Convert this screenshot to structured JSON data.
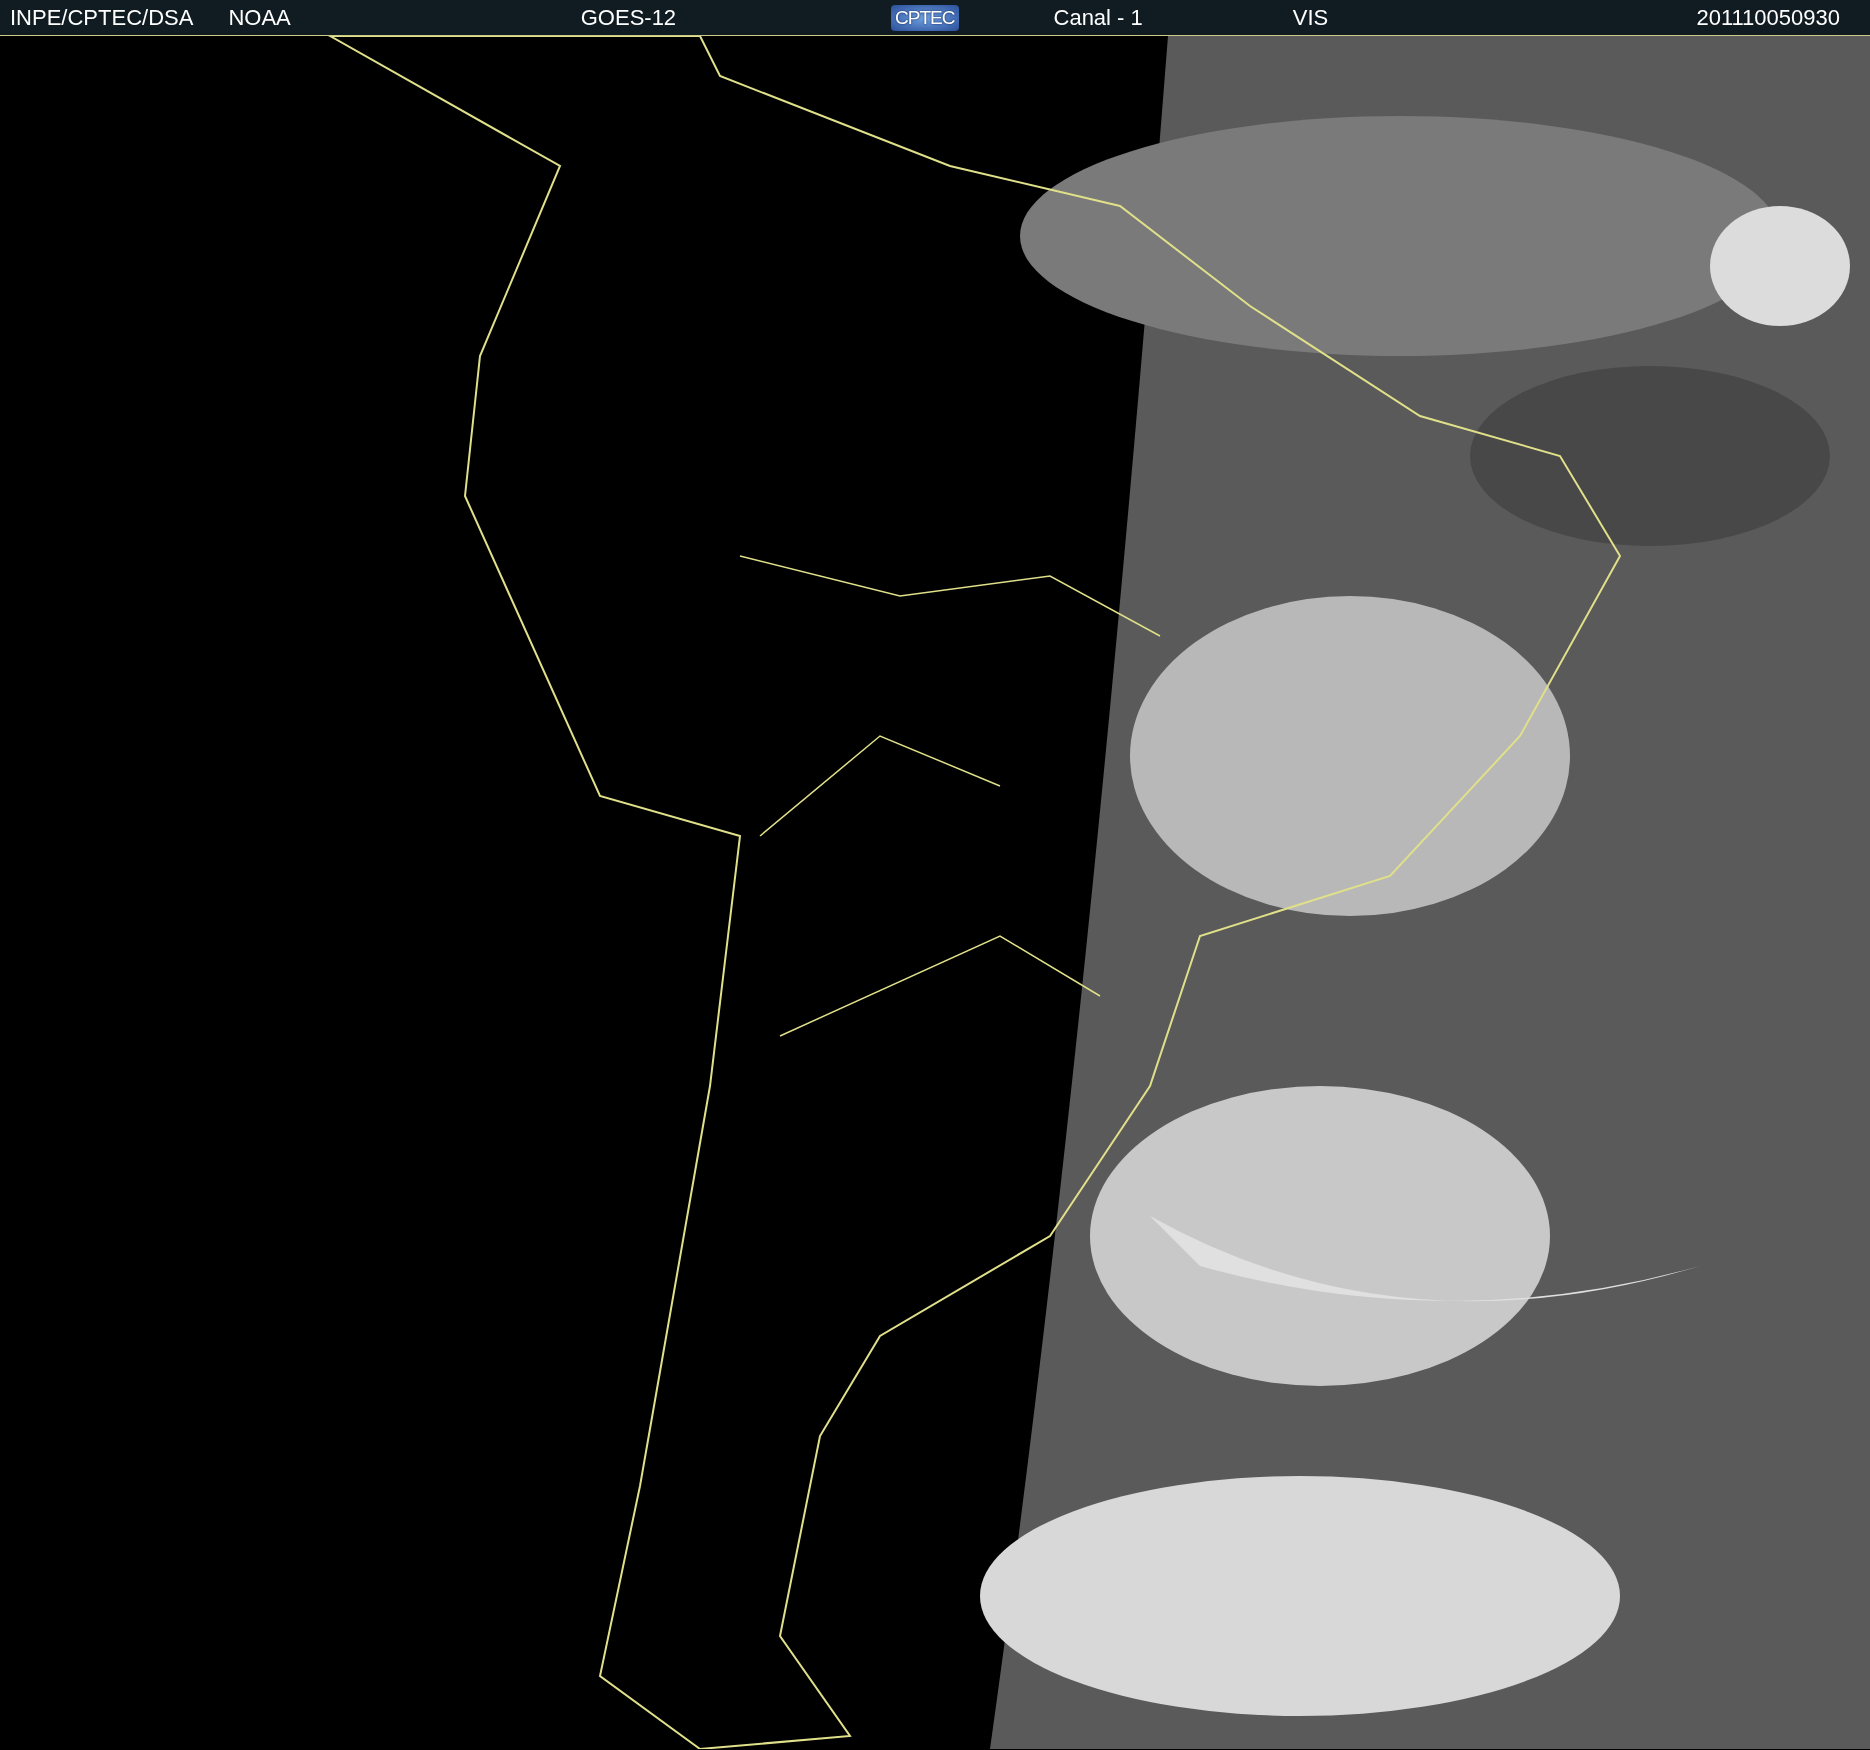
{
  "header": {
    "source": "INPE/CPTEC/DSA",
    "agency": "NOAA",
    "satellite": "GOES-12",
    "logo": "CPTEC",
    "channel": "Canal - 1",
    "band": "VIS",
    "timestamp": "201110050930"
  }
}
